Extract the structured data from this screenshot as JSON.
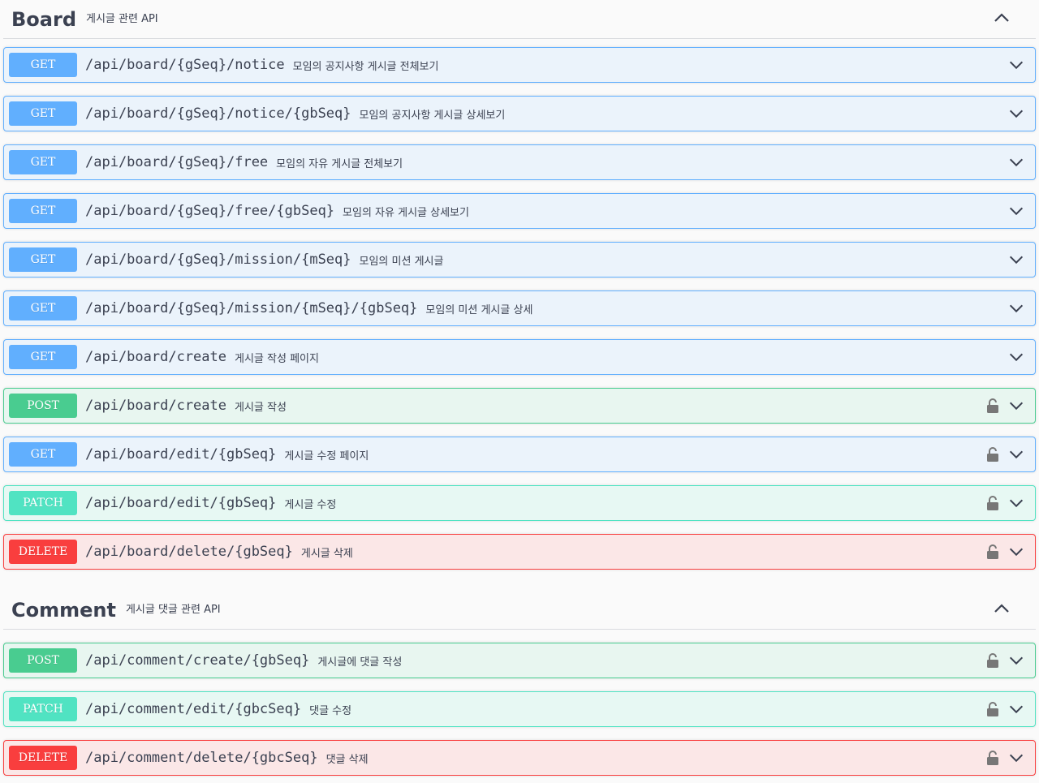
{
  "sections": [
    {
      "name": "Board",
      "description": "게시글 관련 API",
      "operations": [
        {
          "method": "GET",
          "path": "/api/board/{gSeq}/notice",
          "summary": "모임의 공지사항 게시글 전체보기",
          "locked": false
        },
        {
          "method": "GET",
          "path": "/api/board/{gSeq}/notice/{gbSeq}",
          "summary": "모임의 공지사항 게시글 상세보기",
          "locked": false
        },
        {
          "method": "GET",
          "path": "/api/board/{gSeq}/free",
          "summary": "모임의 자유 게시글 전체보기",
          "locked": false
        },
        {
          "method": "GET",
          "path": "/api/board/{gSeq}/free/{gbSeq}",
          "summary": "모임의 자유 게시글 상세보기",
          "locked": false
        },
        {
          "method": "GET",
          "path": "/api/board/{gSeq}/mission/{mSeq}",
          "summary": "모임의 미션 게시글",
          "locked": false
        },
        {
          "method": "GET",
          "path": "/api/board/{gSeq}/mission/{mSeq}/{gbSeq}",
          "summary": "모임의 미션 게시글 상세",
          "locked": false
        },
        {
          "method": "GET",
          "path": "/api/board/create",
          "summary": "게시글 작성 페이지",
          "locked": false
        },
        {
          "method": "POST",
          "path": "/api/board/create",
          "summary": "게시글 작성",
          "locked": true
        },
        {
          "method": "GET",
          "path": "/api/board/edit/{gbSeq}",
          "summary": "게시글 수정 페이지",
          "locked": true
        },
        {
          "method": "PATCH",
          "path": "/api/board/edit/{gbSeq}",
          "summary": "게시글 수정",
          "locked": true
        },
        {
          "method": "DELETE",
          "path": "/api/board/delete/{gbSeq}",
          "summary": "게시글 삭제",
          "locked": true
        }
      ]
    },
    {
      "name": "Comment",
      "description": "게시글 댓글 관련 API",
      "operations": [
        {
          "method": "POST",
          "path": "/api/comment/create/{gbSeq}",
          "summary": "게시글에 댓글 작성",
          "locked": true
        },
        {
          "method": "PATCH",
          "path": "/api/comment/edit/{gbcSeq}",
          "summary": "댓글 수정",
          "locked": true
        },
        {
          "method": "DELETE",
          "path": "/api/comment/delete/{gbcSeq}",
          "summary": "댓글 삭제",
          "locked": true
        }
      ]
    }
  ],
  "colors": {
    "get": "#61affe",
    "post": "#49cc90",
    "patch": "#50e3c2",
    "delete": "#f93e3e",
    "text": "#3b4151"
  },
  "icons": {
    "collapse": "chevron-up-icon",
    "expand": "chevron-down-icon",
    "auth": "lock-icon"
  }
}
